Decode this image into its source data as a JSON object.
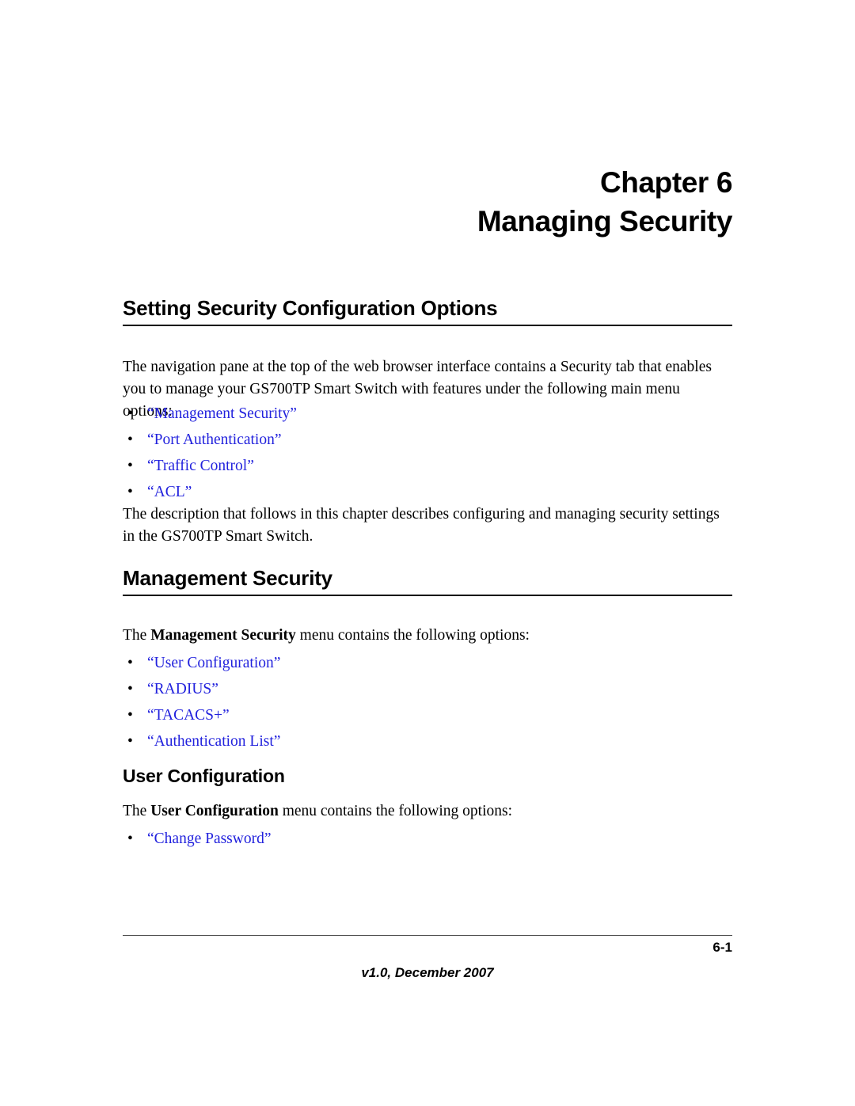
{
  "document": {
    "type": "manual-page",
    "link_color": "#2222dd",
    "text_color": "#000000",
    "background_color": "#ffffff"
  },
  "chapter": {
    "number_line": "Chapter 6",
    "name_line": "Managing Security"
  },
  "sections": {
    "setting_security": {
      "heading": "Setting Security Configuration Options",
      "intro_paragraph": "The navigation pane at the top of the web browser interface contains a Security tab that enables you to manage your GS700TP Smart Switch with features under the following main menu options:",
      "links": [
        {
          "bullet": "•",
          "label": "“Management Security”"
        },
        {
          "bullet": "•",
          "label": "“Port Authentication”"
        },
        {
          "bullet": "•",
          "label": "“Traffic Control”"
        },
        {
          "bullet": "•",
          "label": "“ACL”"
        }
      ],
      "closing_paragraph": "The description that follows in this chapter describes configuring and managing security settings in the GS700TP Smart Switch."
    },
    "management_security": {
      "heading": "Management Security",
      "intro_prefix": "The ",
      "intro_bold": "Management Security",
      "intro_suffix": " menu contains the following options:",
      "links": [
        {
          "bullet": "•",
          "label": "“User Configuration”"
        },
        {
          "bullet": "•",
          "label": "“RADIUS”"
        },
        {
          "bullet": "•",
          "label": "“TACACS+”"
        },
        {
          "bullet": "•",
          "label": "“Authentication List”"
        }
      ]
    },
    "user_configuration": {
      "heading": "User Configuration",
      "intro_prefix": "The ",
      "intro_bold": "User Configuration",
      "intro_suffix": " menu contains the following options:",
      "links": [
        {
          "bullet": "•",
          "label": "“Change Password”"
        }
      ]
    }
  },
  "footer": {
    "page_number": "6-1",
    "version": "v1.0, December 2007"
  }
}
